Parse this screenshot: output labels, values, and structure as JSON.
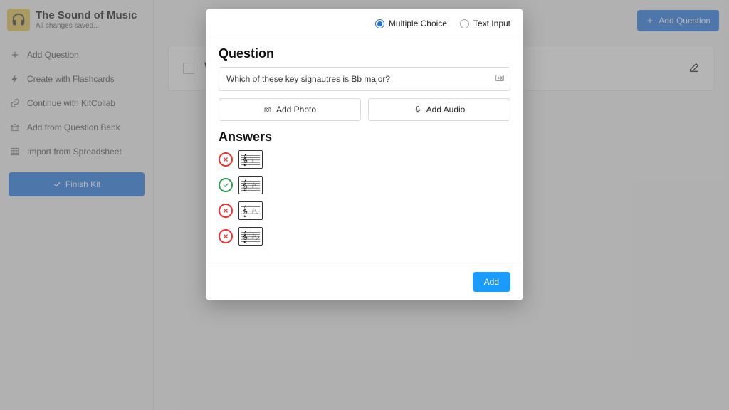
{
  "kit": {
    "title": "The Sound of Music",
    "status": "All changes saved..."
  },
  "sidebar": {
    "items": [
      {
        "label": "Add Question",
        "icon": "plus"
      },
      {
        "label": "Create with Flashcards",
        "icon": "flash"
      },
      {
        "label": "Continue with KitCollab",
        "icon": "link"
      },
      {
        "label": "Add from Question Bank",
        "icon": "bank"
      },
      {
        "label": "Import from Spreadsheet",
        "icon": "grid"
      }
    ],
    "finish_label": "Finish Kit"
  },
  "topbar": {
    "add_question_label": "Add Question"
  },
  "question_card": {
    "title_preview": "Wh",
    "edit_label": "Edit"
  },
  "modal": {
    "tabs": {
      "mc_label": "Multiple Choice",
      "text_label": "Text Input",
      "selected": "mc"
    },
    "question_heading": "Question",
    "question_value": "Which of these key signautres is Bb major?",
    "add_photo_label": "Add Photo",
    "add_audio_label": "Add Audio",
    "answers_heading": "Answers",
    "answers": [
      {
        "correct": false,
        "flats": 1
      },
      {
        "correct": true,
        "flats": 2
      },
      {
        "correct": false,
        "flats": 3
      },
      {
        "correct": false,
        "flats": 4
      }
    ],
    "add_button_label": "Add"
  }
}
